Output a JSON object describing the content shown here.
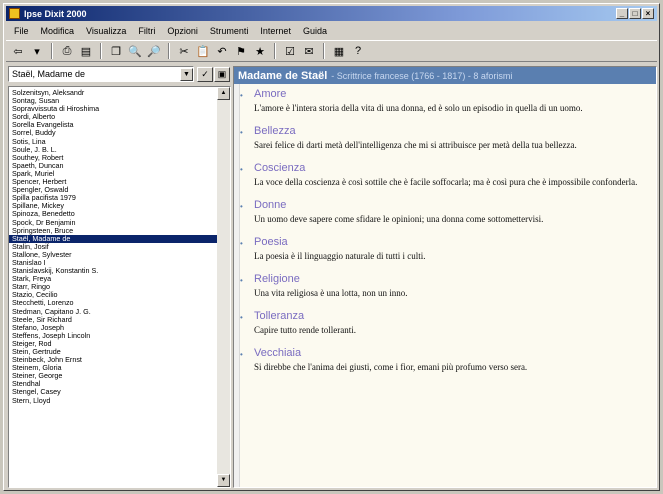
{
  "window": {
    "title": "Ipse Dixit 2000",
    "controls": [
      "_",
      "□",
      "×"
    ]
  },
  "menu": [
    "File",
    "Modifica",
    "Visualizza",
    "Filtri",
    "Opzioni",
    "Strumenti",
    "Internet",
    "Guida"
  ],
  "toolbar": {
    "icons": [
      "back-icon",
      "forward-icon",
      "print-icon",
      "notes-icon",
      "copy-icon",
      "find-icon",
      "find-next-icon",
      "cut-icon",
      "paste-icon",
      "undo-icon",
      "filter-icon",
      "favorite-icon",
      "properties-icon",
      "mail-icon",
      "export-icon",
      "help-icon"
    ]
  },
  "author_select": {
    "value": "Staël, Madame de"
  },
  "authors": [
    "Solzenitsyn, Aleksandr",
    "Sontag, Susan",
    "Sopravvissuta di Hiroshima",
    "Sordi, Alberto",
    "Sorella Evangelista",
    "Sorrel, Buddy",
    "Sotis, Lina",
    "Soule, J. B. L.",
    "Southey, Robert",
    "Spaeth, Duncan",
    "Spark, Muriel",
    "Spencer, Herbert",
    "Spengler, Oswald",
    "Spilla pacifista 1979",
    "Spillane, Mickey",
    "Spinoza, Benedetto",
    "Spock, Dr Benjamin",
    "Springsteen, Bruce",
    "Staël, Madame de",
    "Stalin, Josif",
    "Stallone, Sylvester",
    "Stanislao I",
    "Stanislavskij, Konstantin S.",
    "Stark, Freya",
    "Starr, Ringo",
    "Stazio, Cecilio",
    "Stecchetti, Lorenzo",
    "Stedman, Capitano J. G.",
    "Steele, Sir Richard",
    "Stefano, Joseph",
    "Steffens, Joseph Lincoln",
    "Steiger, Rod",
    "Stein, Gertrude",
    "Steinbeck, John Ernst",
    "Steinem, Gloria",
    "Steiner, George",
    "Stendhal",
    "Stengel, Casey",
    "Stern, Lloyd"
  ],
  "selected_index": 18,
  "header": {
    "name": "Madame de Staël",
    "subtitle": "- Scrittrice francese (1766 - 1817) - 8 aforismi"
  },
  "topics": [
    {
      "title": "Amore",
      "quote": "L'amore è l'intera storia della vita di una donna, ed è solo un episodio in quella di un uomo."
    },
    {
      "title": "Bellezza",
      "quote": "Sarei felice di darti metà dell'intelligenza che mi si attribuisce per metà della tua bellezza."
    },
    {
      "title": "Coscienza",
      "quote": "La voce della coscienza è così sottile che è facile soffocarla; ma è così pura che è impossibile confonderla."
    },
    {
      "title": "Donne",
      "quote": "Un uomo deve sapere come sfidare le opinioni; una donna come sottomettervisi."
    },
    {
      "title": "Poesia",
      "quote": "La poesia è il linguaggio naturale di tutti i culti."
    },
    {
      "title": "Religione",
      "quote": "Una vita religiosa è una lotta, non un inno."
    },
    {
      "title": "Tolleranza",
      "quote": "Capire tutto rende tolleranti."
    },
    {
      "title": "Vecchiaia",
      "quote": "Si direbbe che l'anima dei giusti, come i fior, emani più profumo verso sera."
    }
  ]
}
